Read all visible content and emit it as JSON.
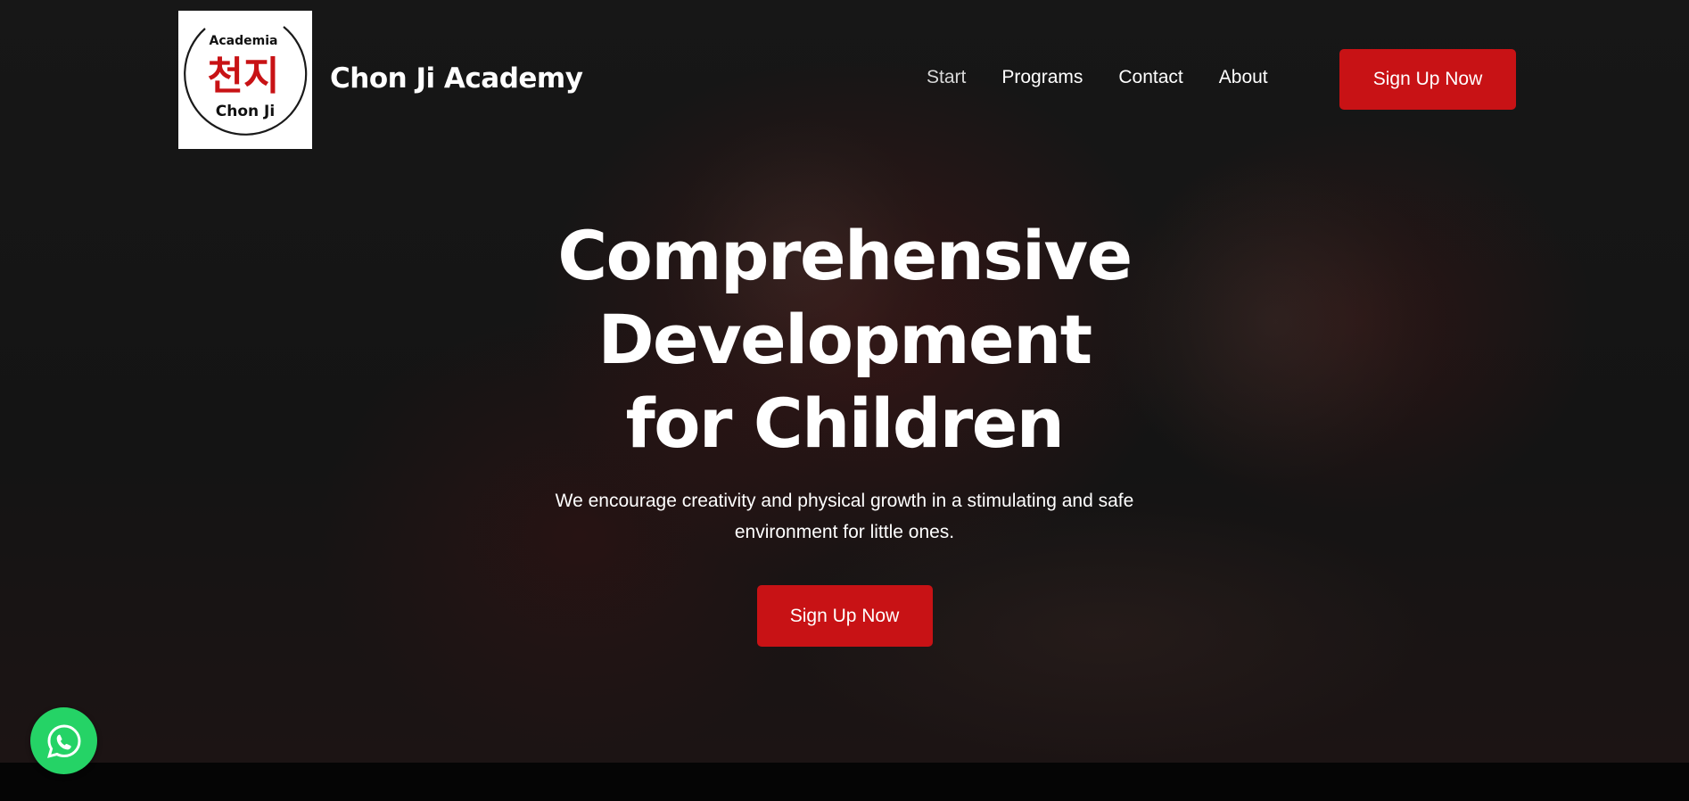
{
  "header": {
    "logo": {
      "top_text": "Academia",
      "korean_text": "천지",
      "bottom_text": "Chon Ji"
    },
    "brand_name": "Chon Ji Academy",
    "nav": [
      {
        "label": "Start",
        "active": true
      },
      {
        "label": "Programs",
        "active": false
      },
      {
        "label": "Contact",
        "active": false
      },
      {
        "label": "About",
        "active": false
      }
    ],
    "cta_label": "Sign Up Now"
  },
  "hero": {
    "title_line1": "Comprehensive Development",
    "title_line2": "for Children",
    "subtitle_line1": "We encourage creativity and physical growth in a stimulating and safe",
    "subtitle_line2": "environment for little ones.",
    "cta_label": "Sign Up Now"
  },
  "floating": {
    "whatsapp_icon": "whatsapp-icon"
  },
  "colors": {
    "accent": "#c81215",
    "whatsapp": "#25d366",
    "text": "#ffffff"
  }
}
